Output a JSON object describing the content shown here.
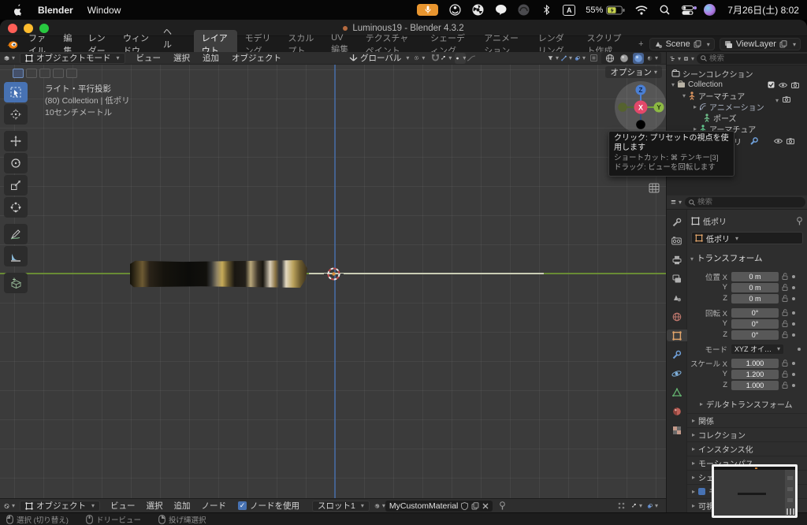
{
  "menubar": {
    "app_name": "Blender",
    "window_menu": "Window",
    "battery_percent": "55%",
    "input_source": "A",
    "clock": "7月26日(土) 8:02"
  },
  "window": {
    "title": "Luminous19 - Blender 4.3.2"
  },
  "topbar": {
    "menus": [
      "ファイル",
      "編集",
      "レンダー",
      "ウィンドウ",
      "ヘルプ"
    ],
    "tabs": [
      "レイアウト",
      "モデリング",
      "スカルプト",
      "UV編集",
      "テクスチャペイント",
      "シェーディング",
      "アニメーション",
      "レンダリング",
      "スクリプト作成"
    ],
    "active_tab": "レイアウト",
    "add_tab_label": "+",
    "scene_name": "Scene",
    "view_layer_name": "ViewLayer"
  },
  "viewport": {
    "mode": "オブジェクトモード",
    "menus": [
      "ビュー",
      "選択",
      "追加",
      "オブジェクト"
    ],
    "orientation": "グローバル",
    "info_lines": [
      "ライト・平行投影",
      "(80) Collection | 低ポリ",
      "10センチメートル"
    ],
    "options_label": "オプション",
    "gizmo": {
      "x": "X",
      "y": "Y",
      "z": "Z"
    }
  },
  "tooltip": {
    "line1": "クリック: プリセットの視点を使用します",
    "line2": "ショートカット: ⌘ テンキー[3]",
    "line3": "ドラッグ: ビューを回転します"
  },
  "outliner": {
    "search_placeholder": "検索",
    "rows": [
      {
        "label": "シーンコレクション"
      },
      {
        "label": "Collection"
      },
      {
        "label": "アーマチュア"
      },
      {
        "label": "アニメーション"
      },
      {
        "label": "ポーズ"
      },
      {
        "label": "アーマチュア"
      },
      {
        "label": "低ポリ"
      }
    ]
  },
  "properties": {
    "search_placeholder": "検索",
    "breadcrumb_object": "低ポリ",
    "object_name": "低ポリ",
    "transform": {
      "title": "トランスフォーム",
      "loc_x_label": "位置 X",
      "loc_x": "0 m",
      "loc_y_label": "Y",
      "loc_y": "0 m",
      "loc_z_label": "Z",
      "loc_z": "0 m",
      "rot_x_label": "回転 X",
      "rot_x": "0°",
      "rot_y_label": "Y",
      "rot_y": "0°",
      "rot_z_label": "Z",
      "rot_z": "0°",
      "mode_label": "モード",
      "mode_value": "XYZ オイ…",
      "scale_x_label": "スケール X",
      "scale_x": "1.000",
      "scale_y_label": "Y",
      "scale_y": "1.200",
      "scale_z_label": "Z",
      "scale_z": "1.000",
      "subpanel": "デルタトランスフォーム"
    },
    "panels": [
      "関係",
      "コレクション",
      "インスタンス化",
      "モーションパス",
      "シェ",
      "モ",
      "可視性"
    ]
  },
  "shader": {
    "object_type": "オブジェクト",
    "menus": [
      "ビュー",
      "選択",
      "追加",
      "ノード"
    ],
    "use_nodes_label": "ノードを使用",
    "slot_label": "スロット1",
    "material_name": "MyCustomMaterial"
  },
  "statusbar": {
    "hints": [
      "選択 (切り替え)",
      "ドリービュー",
      "投げ縄選択"
    ]
  }
}
